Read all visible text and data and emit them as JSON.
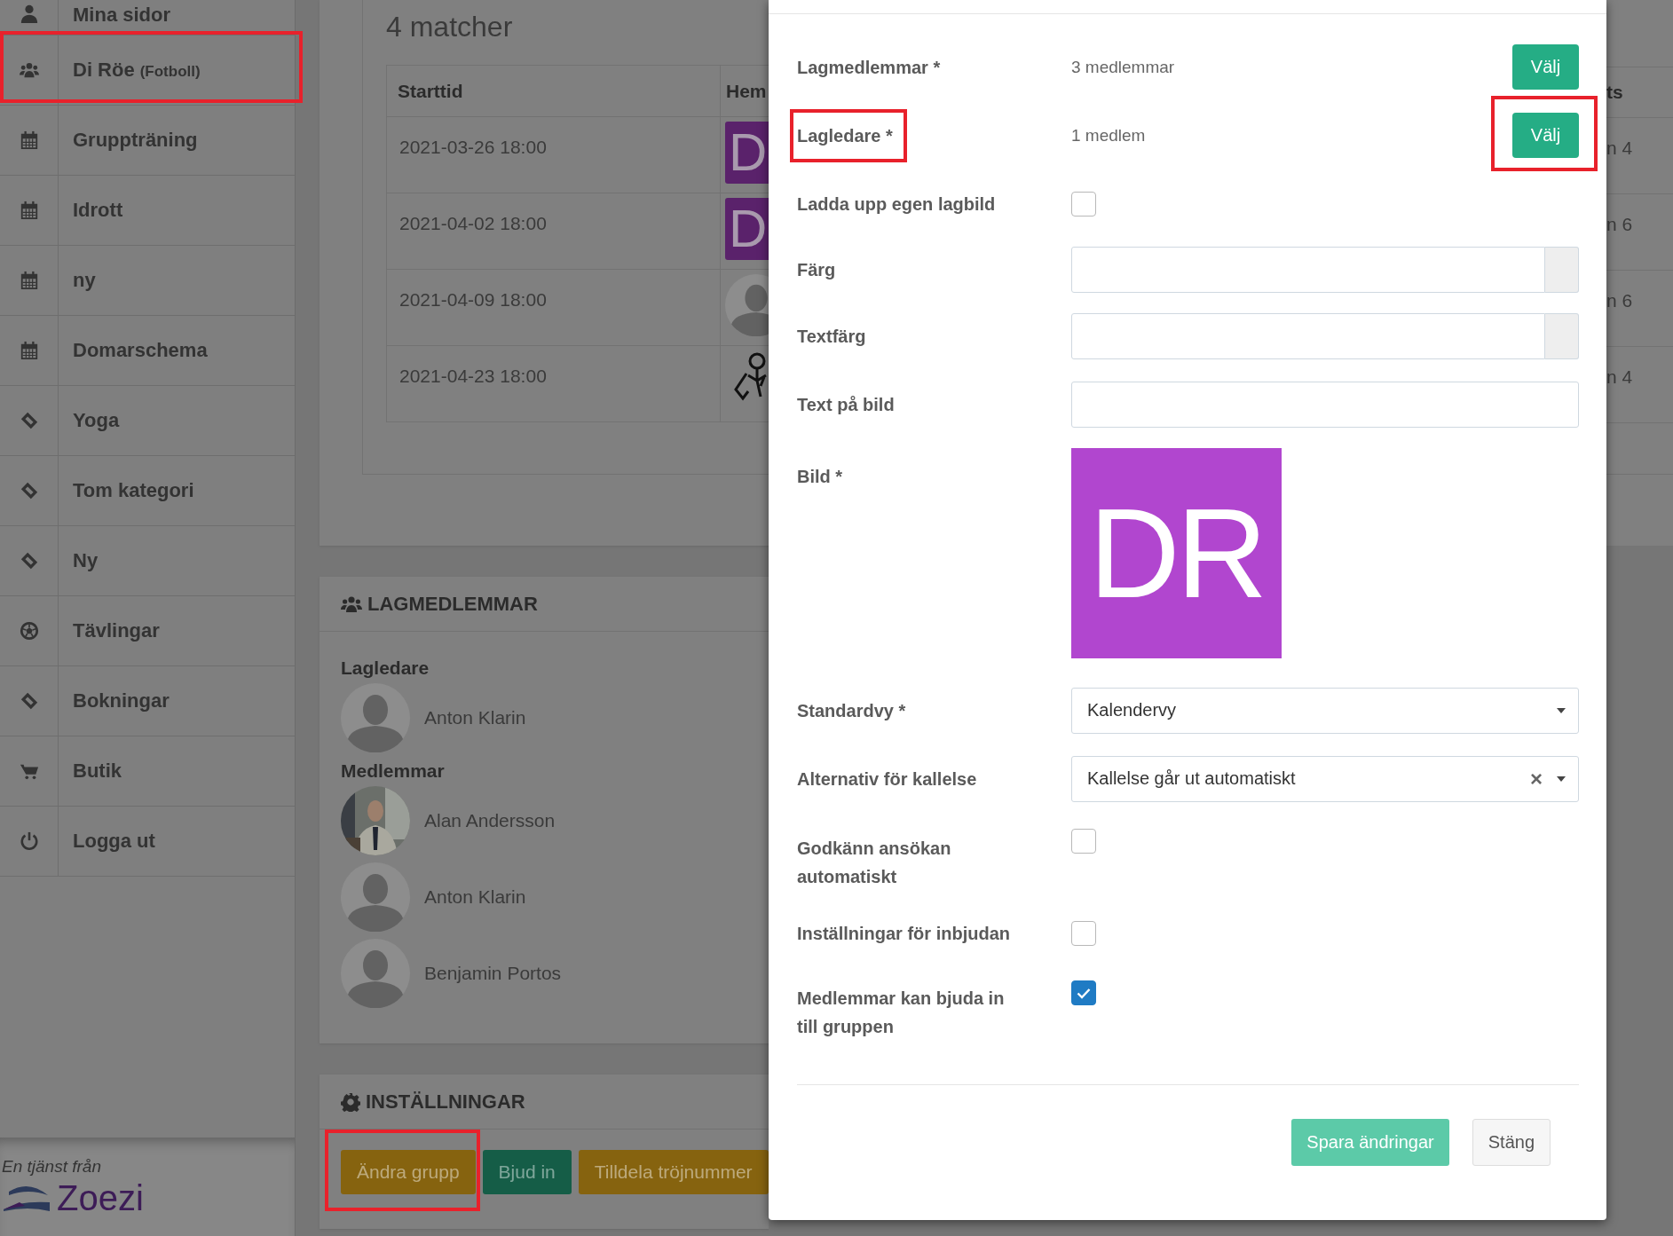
{
  "sidebar": {
    "items": [
      {
        "kind": "user",
        "label": "Mina sidor",
        "highlighted": false
      },
      {
        "kind": "group",
        "label": "Di Röe",
        "sublabel": "(Fotboll)",
        "highlighted": true
      },
      {
        "kind": "calendar",
        "label": "Gruppträning",
        "highlighted": false
      },
      {
        "kind": "calendar",
        "label": "Idrott",
        "highlighted": false
      },
      {
        "kind": "calendar",
        "label": "ny",
        "highlighted": false
      },
      {
        "kind": "calendar",
        "label": "Domarschema",
        "highlighted": false
      },
      {
        "kind": "ticket",
        "label": "Yoga",
        "highlighted": false
      },
      {
        "kind": "ticket",
        "label": "Tom kategori",
        "highlighted": false
      },
      {
        "kind": "ticket",
        "label": "Ny",
        "highlighted": false
      },
      {
        "kind": "ball",
        "label": "Tävlingar",
        "highlighted": false
      },
      {
        "kind": "ticket",
        "label": "Bokningar",
        "highlighted": false
      },
      {
        "kind": "cart",
        "label": "Butik",
        "highlighted": false
      },
      {
        "kind": "power",
        "label": "Logga ut",
        "highlighted": false
      }
    ]
  },
  "footer": {
    "tagline": "En tjänst från",
    "brand": "Zoezi"
  },
  "matches": {
    "title": "4 matcher",
    "columns": [
      "Starttid",
      "Hem",
      "ts"
    ],
    "rows": [
      {
        "start": "2021-03-26 18:00",
        "home": {
          "kind": "logo",
          "text": "D"
        },
        "column_3": "n 4"
      },
      {
        "start": "2021-04-02 18:00",
        "home": {
          "kind": "logo",
          "text": "D"
        },
        "column_3": "n 6"
      },
      {
        "start": "2021-04-09 18:00",
        "home": {
          "kind": "silhouette"
        },
        "column_3": "n 6"
      },
      {
        "start": "2021-04-23 18:00",
        "home": {
          "kind": "figure"
        },
        "column_3": "n 4"
      }
    ]
  },
  "members": {
    "title": "LAGMEDLEMMAR",
    "groups": [
      {
        "heading": "Lagledare",
        "people": [
          {
            "name": "Anton Klarin",
            "kind": "silhouette"
          }
        ]
      },
      {
        "heading": "Medlemmar",
        "people": [
          {
            "name": "Alan Andersson",
            "kind": "picture"
          },
          {
            "name": "Anton Klarin",
            "kind": "silhouette"
          },
          {
            "name": "Benjamin Portos",
            "kind": "silhouette"
          }
        ]
      }
    ]
  },
  "settings": {
    "title": "INSTÄLLNINGAR",
    "buttons": [
      {
        "label": "Ändra grupp",
        "color": "#86630f",
        "highlighted": true
      },
      {
        "label": "Bjud in",
        "color": "#155d47",
        "highlighted": false
      },
      {
        "label": "Tilldela tröjnummer",
        "color": "#86630f",
        "highlighted": false
      }
    ]
  },
  "modal": {
    "rows": [
      {
        "kind": "count",
        "label": "Lagmedlemmar *",
        "value": "3 medlemmar",
        "button": "Välj",
        "highlighted": false
      },
      {
        "kind": "count",
        "label": "Lagledare *",
        "value": "1 medlem",
        "button": "Välj",
        "highlighted": true
      },
      {
        "kind": "checkbox",
        "label": "Ladda upp egen lagbild",
        "checked": false
      },
      {
        "kind": "color",
        "label": "Färg"
      },
      {
        "kind": "color",
        "label": "Textfärg"
      },
      {
        "kind": "text",
        "label": "Text på bild"
      },
      {
        "label": "Bild *",
        "image_text": "DR"
      },
      {
        "kind": "select",
        "label": "Standardvy *",
        "value": "Kalendervy"
      },
      {
        "kind": "select",
        "label": "Alternativ för kallelse",
        "value": "Kallelse går ut automatiskt",
        "clear": "×"
      },
      {
        "kind": "checkbox",
        "label": "Godkänn ansökan automatiskt",
        "checked": false
      },
      {
        "kind": "checkbox",
        "label": "Inställningar för inbjudan",
        "checked": false
      },
      {
        "kind": "checkbox",
        "label": "Medlemmar kan bjuda in till gruppen",
        "checked": true
      }
    ],
    "buttons": [
      {
        "label": "Spara ändringar",
        "kind": "primary"
      },
      {
        "label": "Stäng",
        "kind": "default"
      }
    ]
  }
}
